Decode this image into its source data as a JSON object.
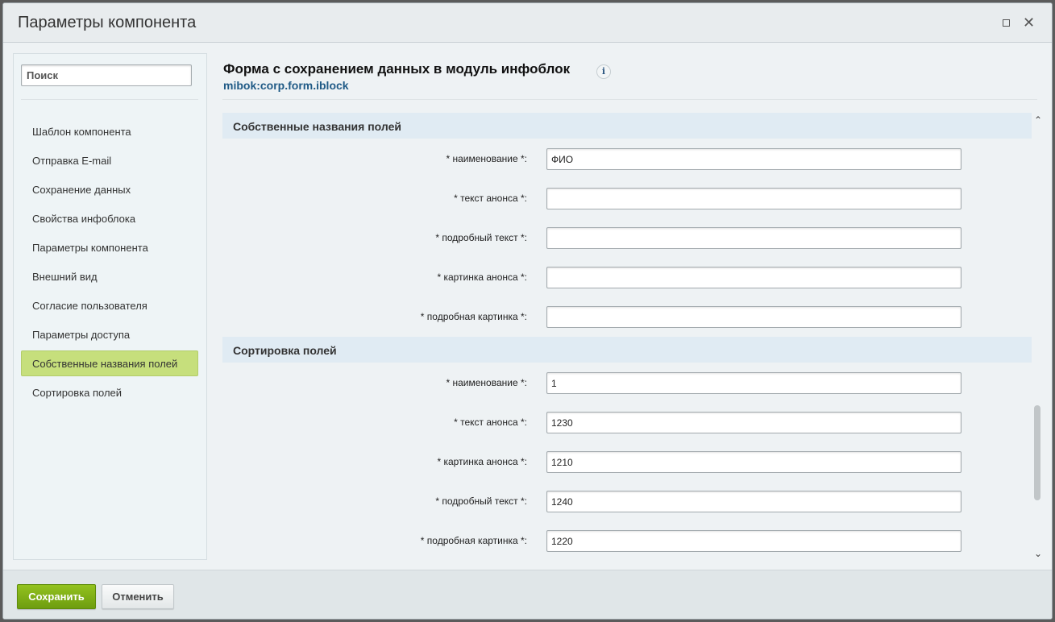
{
  "window": {
    "title": "Параметры компонента",
    "controls": [
      "maximize-icon",
      "close-icon"
    ]
  },
  "sidebar": {
    "search_placeholder": "Поиск",
    "items": [
      {
        "label": "Шаблон компонента",
        "active": false
      },
      {
        "label": "Отправка E-mail",
        "active": false
      },
      {
        "label": "Сохранение данных",
        "active": false
      },
      {
        "label": "Свойства инфоблока",
        "active": false
      },
      {
        "label": "Параметры компонента",
        "active": false
      },
      {
        "label": "Внешний вид",
        "active": false
      },
      {
        "label": "Согласие пользователя",
        "active": false
      },
      {
        "label": "Параметры доступа",
        "active": false
      },
      {
        "label": "Собственные названия полей",
        "active": true
      },
      {
        "label": "Сортировка полей",
        "active": false
      }
    ]
  },
  "main": {
    "title": "Форма с сохранением данных в модуль инфоблок",
    "component_code": "mibok:corp.form.iblock",
    "sections": [
      {
        "title": "Собственные названия полей",
        "fields": [
          {
            "label": "* наименование *:",
            "value": "ФИО"
          },
          {
            "label": "* текст анонса *:",
            "value": ""
          },
          {
            "label": "* подробный текст *:",
            "value": ""
          },
          {
            "label": "* картинка анонса *:",
            "value": ""
          },
          {
            "label": "* подробная картинка *:",
            "value": ""
          }
        ]
      },
      {
        "title": "Сортировка полей",
        "fields": [
          {
            "label": "* наименование *:",
            "value": "1"
          },
          {
            "label": "* текст анонса *:",
            "value": "1230"
          },
          {
            "label": "* картинка анонса *:",
            "value": "1210"
          },
          {
            "label": "* подробный текст *:",
            "value": "1240"
          },
          {
            "label": "* подробная картинка *:",
            "value": "1220"
          }
        ]
      }
    ]
  },
  "footer": {
    "save_label": "Сохранить",
    "cancel_label": "Отменить"
  },
  "colors": {
    "active_nav": "#c6df7c",
    "save_button": "#7fb115",
    "section_header": "#e0ebf3",
    "component_code": "#1f5a86"
  }
}
